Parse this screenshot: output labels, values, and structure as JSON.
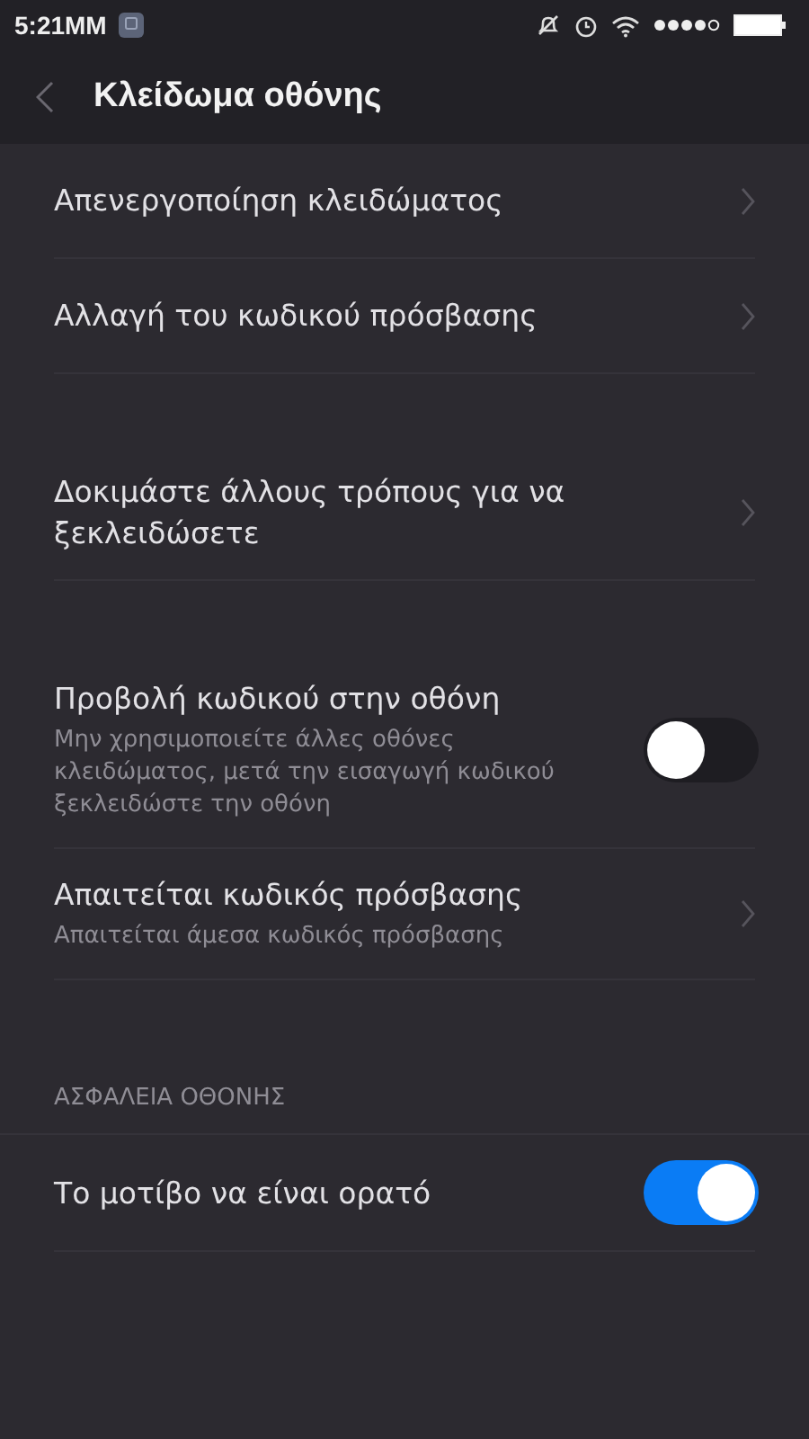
{
  "status_bar": {
    "time": "5:21MM"
  },
  "header": {
    "title": "Κλείδωμα οθόνης"
  },
  "sections": [
    {
      "items": [
        {
          "kind": "nav",
          "label": "Απενεργοποίηση κλειδώματος"
        },
        {
          "kind": "nav",
          "label": "Αλλαγή του κωδικού πρόσβασης"
        }
      ]
    },
    {
      "items": [
        {
          "kind": "nav",
          "label": "Δοκιμάστε άλλους τρόπους για να ξεκλειδώσετε"
        }
      ]
    },
    {
      "items": [
        {
          "kind": "toggle",
          "label": "Προβολή κωδικού στην οθόνη",
          "description": "Μην χρησιμοποιείτε άλλες οθόνες κλειδώματος, μετά την εισαγωγή κωδικού ξεκλειδώστε την οθόνη",
          "on": false
        },
        {
          "kind": "nav",
          "label": "Απαιτείται κωδικός πρόσβασης",
          "description": "Απαιτείται άμεσα κωδικός πρόσβασης"
        }
      ]
    },
    {
      "header": "ΑΣΦΑΛΕΙΑ ΟΘΟΝΗΣ",
      "items": [
        {
          "kind": "toggle",
          "label": "Το μοτίβο να είναι ορατό",
          "on": true
        }
      ]
    }
  ]
}
